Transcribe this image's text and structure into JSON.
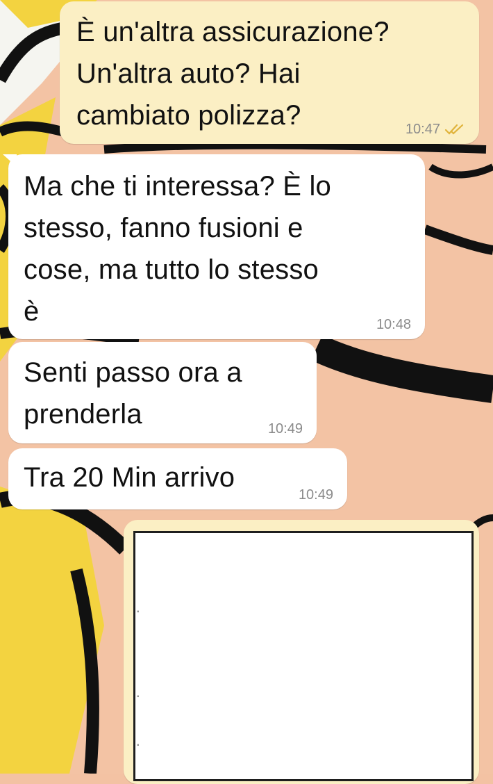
{
  "messages": [
    {
      "direction": "outgoing",
      "text": "È un'altra assicurazione?\nUn'altra auto? Hai\ncambiato polizza?",
      "time": "10:47",
      "status_icon": "double-check-icon"
    },
    {
      "direction": "incoming",
      "text": "Ma che ti interessa? È lo\nstesso, fanno fusioni e\ncose, ma tutto lo stesso\nè",
      "time": "10:48"
    },
    {
      "direction": "incoming",
      "text": "Senti passo ora a\nprenderla",
      "time": "10:49"
    },
    {
      "direction": "incoming",
      "text": "Tra 20 Min arrivo",
      "time": "10:49"
    }
  ],
  "image_message": {
    "direction": "outgoing",
    "content": "document-photo"
  },
  "colors": {
    "outgoing_bubble": "#fbefc4",
    "incoming_bubble": "#ffffff",
    "time_text": "#8b8b8b",
    "read_ticks": "#e0b33b"
  }
}
